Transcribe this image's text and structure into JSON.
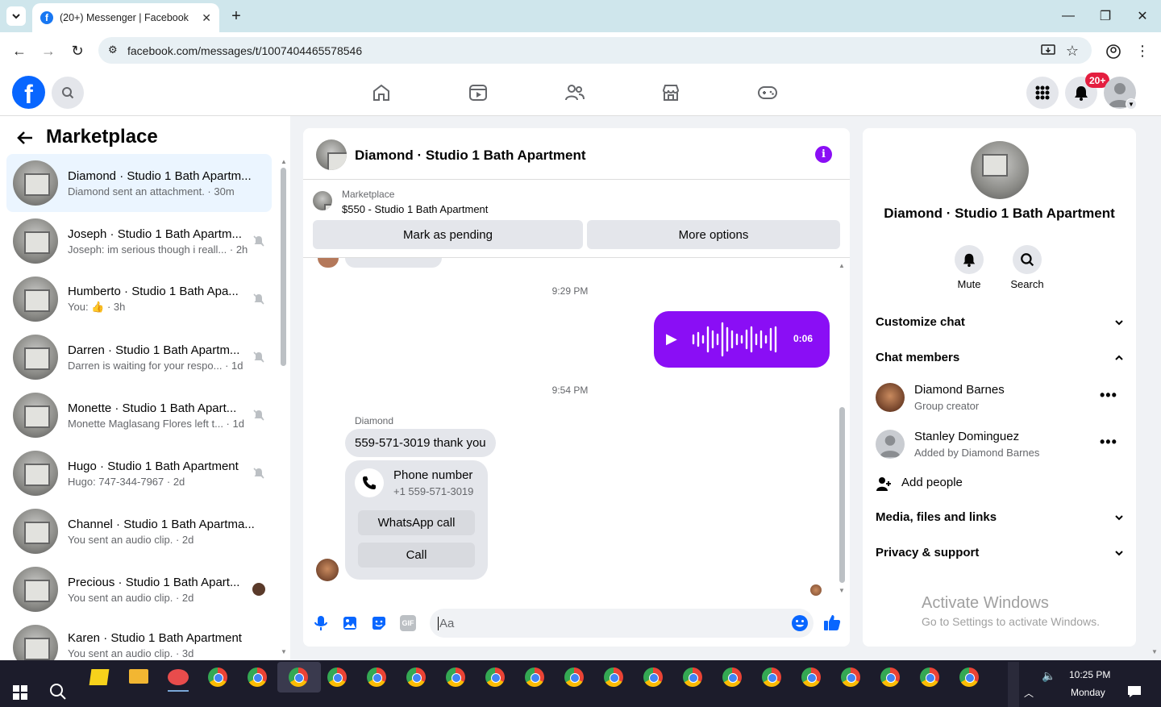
{
  "browser": {
    "tab_title": "(20+) Messenger | Facebook",
    "url": "facebook.com/messages/t/1007404465578546"
  },
  "header": {
    "logo": "f",
    "notif_badge": "20+"
  },
  "left": {
    "title": "Marketplace",
    "conversations": [
      {
        "name": "Diamond · Studio 1 Bath Apartm...",
        "preview": "Diamond sent an attachment. · 30m",
        "muted": false
      },
      {
        "name": "Joseph · Studio 1 Bath Apartm...",
        "preview": "Joseph: im serious though i reall... · 2h",
        "muted": true
      },
      {
        "name": "Humberto · Studio 1 Bath Apa...",
        "preview": "You: 👍 · 3h",
        "muted": true
      },
      {
        "name": "Darren · Studio 1 Bath Apartm...",
        "preview": "Darren is waiting for your respo... · 1d",
        "muted": true
      },
      {
        "name": "Monette · Studio 1 Bath Apart...",
        "preview": "Monette Maglasang Flores left t... · 1d",
        "muted": true
      },
      {
        "name": "Hugo · Studio 1 Bath Apartment",
        "preview": "Hugo: 747-344-7967 · 2d",
        "muted": true
      },
      {
        "name": "Channel · Studio 1 Bath Apartma...",
        "preview": "You sent an audio clip. · 2d",
        "muted": false
      },
      {
        "name": "Precious · Studio 1 Bath Apart...",
        "preview": "You sent an audio clip. · 2d",
        "muted": false
      },
      {
        "name": "Karen · Studio 1 Bath Apartment",
        "preview": "You sent an audio clip. · 3d",
        "muted": false
      }
    ]
  },
  "chat": {
    "title": "Diamond · Studio 1 Bath Apartment",
    "listing_label": "Marketplace",
    "listing_price": "$550 - Studio 1 Bath Apartment",
    "mark_pending": "Mark as pending",
    "more_options": "More options",
    "time1": "9:29 PM",
    "audio_duration": "0:06",
    "time2": "9:54 PM",
    "sender": "Diamond",
    "message": "559-571-3019 thank you",
    "phone_card_title": "Phone number",
    "phone_card_number": "+1 559-571-3019",
    "whatsapp_call": "WhatsApp call",
    "call": "Call",
    "input_placeholder": "Aa"
  },
  "right": {
    "title": "Diamond · Studio 1 Bath Apartment",
    "mute": "Mute",
    "search": "Search",
    "customize_chat": "Customize chat",
    "chat_members": "Chat members",
    "members": [
      {
        "name": "Diamond Barnes",
        "role": "Group creator"
      },
      {
        "name": "Stanley Dominguez",
        "role": "Added by Diamond Barnes"
      }
    ],
    "add_people": "Add people",
    "media": "Media, files and links",
    "privacy": "Privacy & support",
    "watermark_title": "Activate Windows",
    "watermark_sub": "Go to Settings to activate Windows."
  },
  "taskbar": {
    "time": "10:25 PM",
    "day": "Monday"
  },
  "colors": {
    "accent": "#0866ff",
    "purple": "#8a0ef5",
    "badge": "#e41e3f"
  }
}
